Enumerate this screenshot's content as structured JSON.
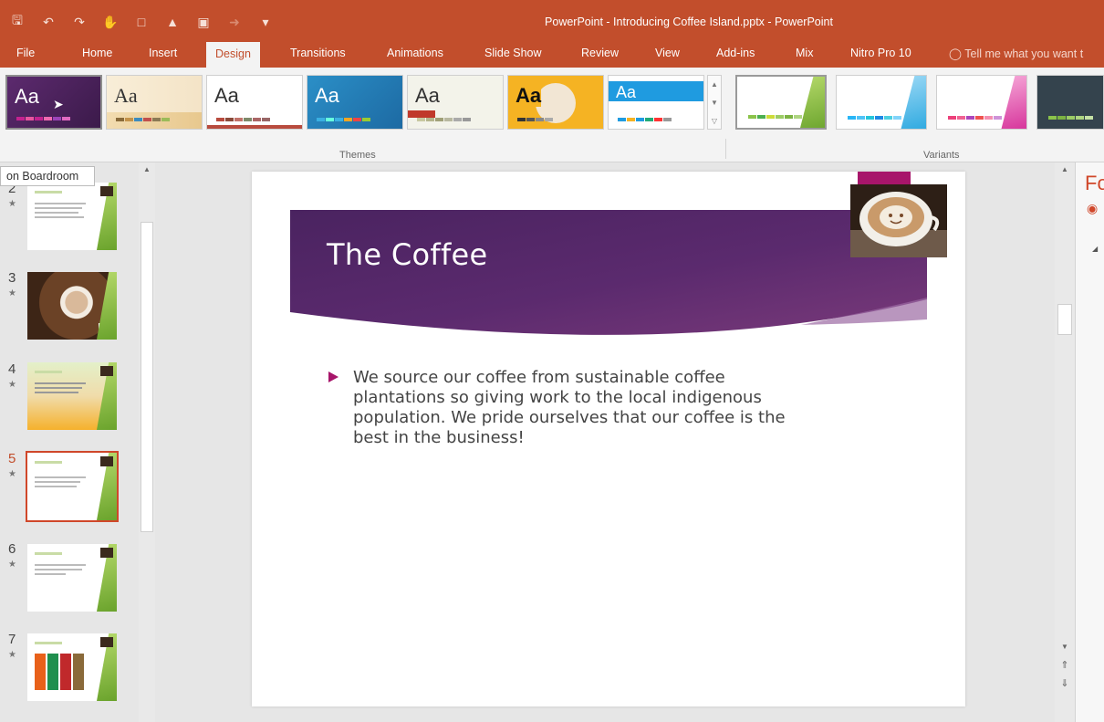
{
  "window": {
    "title": "PowerPoint - Introducing Coffee Island.pptx - PowerPoint"
  },
  "quick_access": [
    "save-icon",
    "undo-icon",
    "redo-icon",
    "touch-mode-icon",
    "new-icon",
    "open-icon",
    "image-icon",
    "format-painter-icon",
    "customize-icon"
  ],
  "ribbon_tabs": [
    {
      "label": "File"
    },
    {
      "label": "Home"
    },
    {
      "label": "Insert"
    },
    {
      "label": "Design",
      "active": true
    },
    {
      "label": "Transitions"
    },
    {
      "label": "Animations"
    },
    {
      "label": "Slide Show"
    },
    {
      "label": "Review"
    },
    {
      "label": "View"
    },
    {
      "label": "Add-ins"
    },
    {
      "label": "Mix"
    },
    {
      "label": "Nitro Pro 10"
    }
  ],
  "tell_me": "Tell me what you want t",
  "themes": {
    "group_label": "Themes",
    "items": [
      {
        "sample": "Aa"
      },
      {
        "sample": "Aa"
      },
      {
        "sample": "Aa"
      },
      {
        "sample": "Aa"
      },
      {
        "sample": "Aa"
      },
      {
        "sample": "Aa"
      },
      {
        "sample": "Aa"
      }
    ]
  },
  "variants": {
    "group_label": "Variants"
  },
  "tooltip": "on Boardroom",
  "slides": [
    {
      "number": "2"
    },
    {
      "number": "3"
    },
    {
      "number": "4"
    },
    {
      "number": "5",
      "active": true
    },
    {
      "number": "6"
    },
    {
      "number": "7"
    }
  ],
  "current_slide": {
    "title": "The Coffee",
    "bullet": "We source our coffee from sustainable coffee plantations so giving work to the local indigenous population. We pride ourselves that our coffee is the best in the business!"
  },
  "format_pane": {
    "title_partial": "Fo"
  },
  "colors": {
    "accent": "#c24e2c",
    "slide_banner": "#5b2a6e",
    "bullet": "#a7156a"
  }
}
